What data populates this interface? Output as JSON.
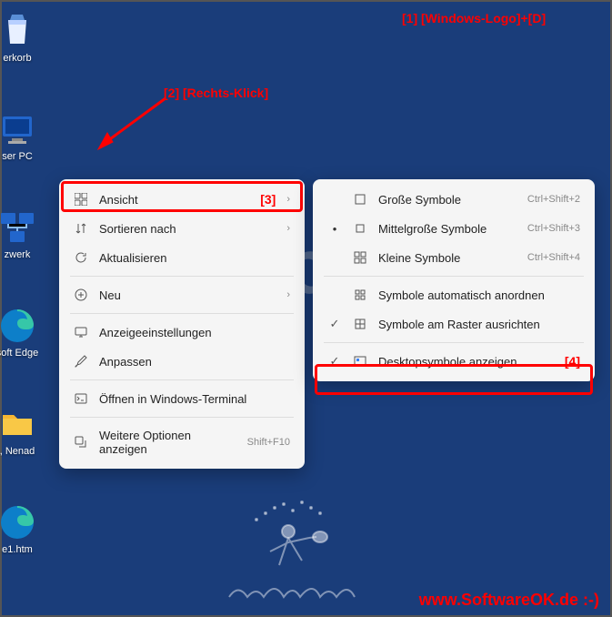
{
  "annotations": {
    "a1": "[1]   [Windows-Logo]+[D]",
    "a2": "[2]   [Rechts-Klick]",
    "a3": "[3]",
    "a4": "[4]"
  },
  "watermark": "SoftwareOK.de",
  "site_label": "www.SoftwareOK.de :-)",
  "desktop_icons": {
    "recycle": "erkorb",
    "pc": "ser PC",
    "network": "zwerk",
    "edge1": "soft Edge",
    "folder": ", Nenad",
    "edge2": "e1.htm"
  },
  "menu1": {
    "view": "Ansicht",
    "sort": "Sortieren nach",
    "refresh": "Aktualisieren",
    "new": "Neu",
    "display": "Anzeigeeinstellungen",
    "personalize": "Anpassen",
    "terminal": "Öffnen in Windows-Terminal",
    "more": "Weitere Optionen anzeigen",
    "more_shortcut": "Shift+F10"
  },
  "menu2": {
    "large": "Große Symbole",
    "large_sc": "Ctrl+Shift+2",
    "medium": "Mittelgroße Symbole",
    "medium_sc": "Ctrl+Shift+3",
    "small": "Kleine Symbole",
    "small_sc": "Ctrl+Shift+4",
    "auto": "Symbole automatisch anordnen",
    "grid": "Symbole am Raster ausrichten",
    "show": "Desktopsymbole anzeigen"
  }
}
